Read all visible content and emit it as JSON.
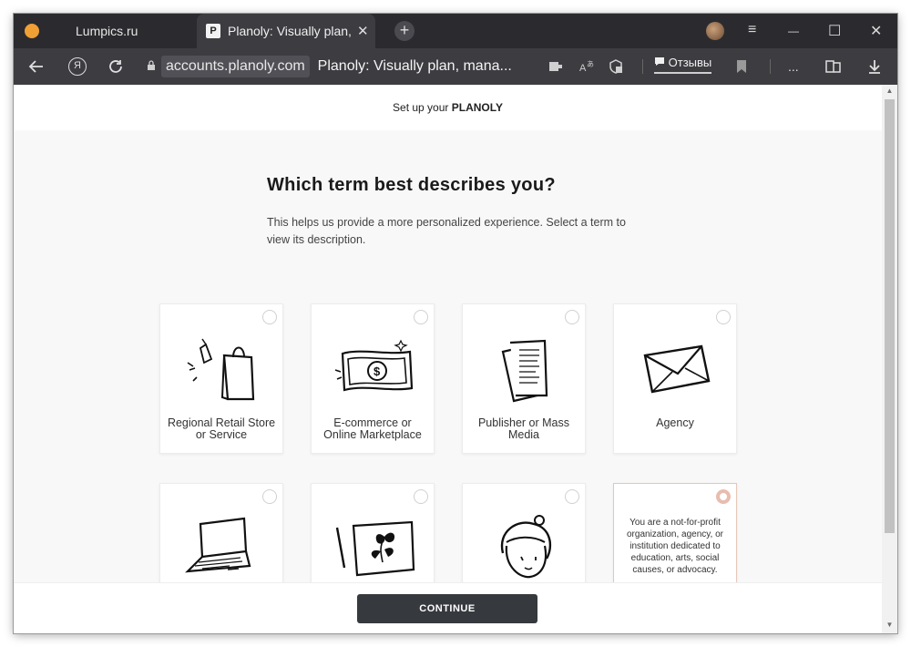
{
  "browser": {
    "tabs": [
      {
        "label": "Lumpics.ru"
      },
      {
        "label": "Planoly: Visually plan, m",
        "favicon": "P"
      }
    ],
    "newtab_glyph": "+",
    "menu_glyph": "≡",
    "minimize_glyph": "—",
    "maximize_glyph": "☐",
    "close_glyph": "✕",
    "tab_close_glyph": "✕",
    "yandex_glyph": "Я",
    "address": {
      "domain": "accounts.planoly.com",
      "page_title": "Planoly: Visually plan, mana..."
    },
    "reviews_label": "Отзывы",
    "more_glyph": "..."
  },
  "page": {
    "header_prefix": "Set up your ",
    "header_brand": "PLANOLY",
    "heading": "Which term best describes you?",
    "subheading": "This helps us provide a more personalized experience. Select a term to view its description.",
    "cards": [
      {
        "label": "Regional Retail Store or Service",
        "icon": "shopping-bag-icon"
      },
      {
        "label": "E-commerce or Online Marketplace",
        "icon": "money-bill-icon"
      },
      {
        "label": "Publisher or Mass Media",
        "icon": "newspaper-icon"
      },
      {
        "label": "Agency",
        "icon": "envelope-icon"
      },
      {
        "label": "",
        "icon": "laptop-icon"
      },
      {
        "label": "",
        "icon": "flower-canvas-icon"
      },
      {
        "label": "",
        "icon": "woman-face-icon"
      },
      {
        "label": "",
        "description": "You are a not-for-profit organization, agency, or institution dedicated to education, arts, social causes, or advocacy.",
        "selected": true
      }
    ],
    "continue_label": "CONTINUE"
  },
  "colors": {
    "accent_selected": "#e7bdb0",
    "button_bg": "#36393d",
    "browser_dark": "#2b2b2f"
  }
}
